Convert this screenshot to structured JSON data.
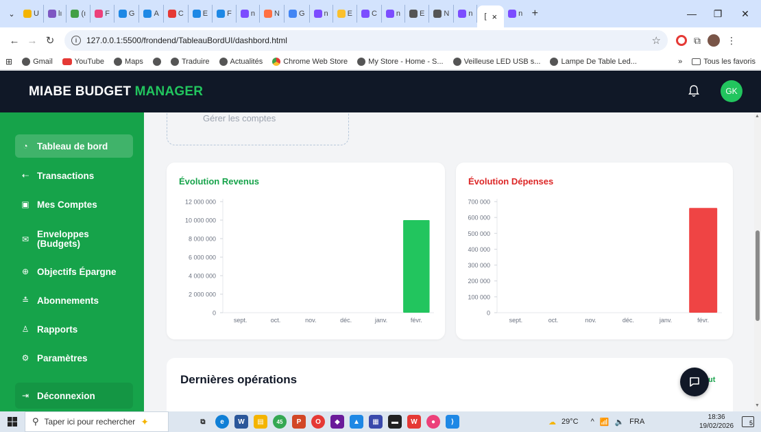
{
  "browser": {
    "tabs": [
      {
        "label": "U",
        "color": "#f4b400"
      },
      {
        "label": "lı",
        "color": "#7e57c2"
      },
      {
        "label": "(ı",
        "color": "#43a047"
      },
      {
        "label": "F",
        "color": "#ec407a"
      },
      {
        "label": "G",
        "color": "#1e88e5"
      },
      {
        "label": "A",
        "color": "#1e88e5"
      },
      {
        "label": "C",
        "color": "#e53935"
      },
      {
        "label": "E",
        "color": "#1e88e5"
      },
      {
        "label": "F",
        "color": "#1e88e5"
      },
      {
        "label": "n",
        "color": "#7c4dff"
      },
      {
        "label": "N",
        "color": "#ff7043"
      },
      {
        "label": "G",
        "color": "#4285f4"
      },
      {
        "label": "n",
        "color": "#7c4dff"
      },
      {
        "label": "E",
        "color": "#fbc02d"
      },
      {
        "label": "C",
        "color": "#7c4dff"
      },
      {
        "label": "n",
        "color": "#7c4dff"
      },
      {
        "label": "E",
        "color": "#555555"
      },
      {
        "label": "N",
        "color": "#555555"
      },
      {
        "label": "n",
        "color": "#7c4dff"
      }
    ],
    "active_tab_label": "[",
    "extra_tab_label": "n",
    "close_glyph": "×",
    "new_tab_glyph": "+",
    "url": "127.0.0.1:5500/frondend/TableauBordUI/dashbord.html",
    "bookmarks": [
      {
        "label": "Gmail",
        "icon": "globe-icon"
      },
      {
        "label": "YouTube",
        "icon": "youtube-icon"
      },
      {
        "label": "Maps",
        "icon": "globe-icon"
      },
      {
        "label": "",
        "icon": "globe-icon"
      },
      {
        "label": "Traduire",
        "icon": "globe-icon"
      },
      {
        "label": "Actualités",
        "icon": "globe-icon"
      },
      {
        "label": "Chrome Web Store",
        "icon": "chrome-web-store-icon"
      },
      {
        "label": "My Store - Home - S...",
        "icon": "globe-icon"
      },
      {
        "label": "Veilleuse LED USB s...",
        "icon": "globe-icon"
      },
      {
        "label": "Lampe De Table Led...",
        "icon": "globe-icon"
      }
    ],
    "bookmarks_more": "»",
    "all_bookmarks_label": "Tous les favoris"
  },
  "app": {
    "brand_white": "MIABE BUDGET ",
    "brand_green": "MANAGER",
    "avatar_initials": "GK",
    "accent": "#16a34a",
    "nav": [
      {
        "label": "Tableau de bord",
        "icon": "◔",
        "active": true
      },
      {
        "label": "Transactions",
        "icon": "⇠"
      },
      {
        "label": "Mes Comptes",
        "icon": "▣"
      },
      {
        "label": "Enveloppes (Budgets)",
        "label_lines": [
          "Enveloppes",
          "(Budgets)"
        ],
        "icon": "✉"
      },
      {
        "label": "Objectifs Épargne",
        "icon": "⊕"
      },
      {
        "label": "Abonnements",
        "icon": "≛"
      },
      {
        "label": "Rapports",
        "icon": "♙"
      },
      {
        "label": "Paramètres",
        "icon": "⚙"
      }
    ],
    "logout_label": "Déconnexion",
    "dashed_card_label": "Gérer les comptes",
    "ops_title": "Dernières opérations",
    "ops_link": "ut"
  },
  "chart_data": [
    {
      "type": "bar",
      "title": "Évolution Revenus",
      "categories": [
        "sept.",
        "oct.",
        "nov.",
        "déc.",
        "janv.",
        "févr."
      ],
      "values": [
        0,
        0,
        0,
        0,
        0,
        10000000
      ],
      "yticks": [
        0,
        2000000,
        4000000,
        6000000,
        8000000,
        10000000,
        12000000
      ],
      "ylim": [
        0,
        12000000
      ],
      "color": "#22c55e",
      "title_color": "#16a34a"
    },
    {
      "type": "bar",
      "title": "Évolution Dépenses",
      "categories": [
        "sept.",
        "oct.",
        "nov.",
        "déc.",
        "janv.",
        "févr."
      ],
      "values": [
        0,
        0,
        0,
        0,
        0,
        660000
      ],
      "yticks": [
        0,
        100000,
        200000,
        300000,
        400000,
        500000,
        600000,
        700000
      ],
      "ylim": [
        0,
        700000
      ],
      "color": "#ef4444",
      "title_color": "#dc2626"
    }
  ],
  "taskbar": {
    "search_placeholder": "Taper ici pour rechercher",
    "weather": "29°C",
    "language": "FRA",
    "time": "18:36",
    "date": "19/02/2026",
    "notification_count": "5",
    "badge_count": "45"
  }
}
